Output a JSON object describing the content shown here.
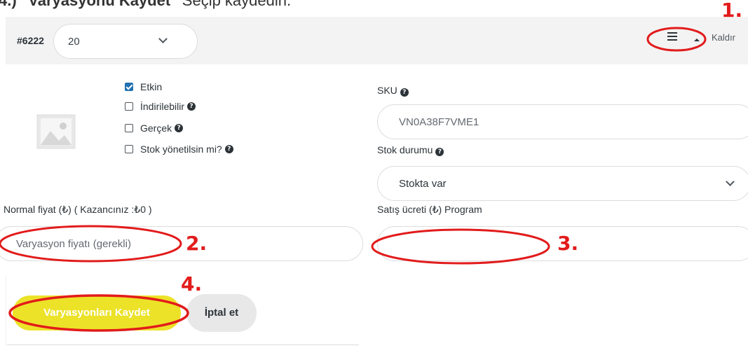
{
  "instruction": {
    "step": "4.)",
    "action": "\"Varyasyonu Kaydet\"",
    "rest": " Seçip kaydedin."
  },
  "variation": {
    "id": "#6222",
    "selected_value": "20",
    "remove_label": "Kaldır"
  },
  "checkboxes": [
    {
      "label": "Etkin",
      "checked": true,
      "help": false
    },
    {
      "label": "İndirilebilir",
      "checked": false,
      "help": true
    },
    {
      "label": "Gerçek",
      "checked": false,
      "help": true
    },
    {
      "label": "Stok yönetilsin mi?",
      "checked": false,
      "help": true
    }
  ],
  "sku": {
    "label": "SKU",
    "value": "VN0A38F7VME1"
  },
  "stock_status": {
    "label": "Stok durumu",
    "value": "Stokta var"
  },
  "regular_price": {
    "label": "Normal fiyat (₺) ( Kazancınız :₺0 )",
    "placeholder": "Varyasyon fiyatı (gerekli)"
  },
  "sale_price": {
    "label": "Satış ücreti (₺) Program",
    "value": ""
  },
  "buttons": {
    "save": "Varyasyonları Kaydet",
    "cancel": "İptal et"
  },
  "annotations": [
    "1.",
    "2.",
    "3.",
    "4."
  ],
  "colors": {
    "annotation": "#e21b1b",
    "save_button": "#ece228",
    "checkbox_on": "#2271b1"
  },
  "icons": [
    "menu-icon",
    "caret-up-icon",
    "chevron-down-icon",
    "image-placeholder-icon",
    "help-icon",
    "checkmark-icon"
  ]
}
